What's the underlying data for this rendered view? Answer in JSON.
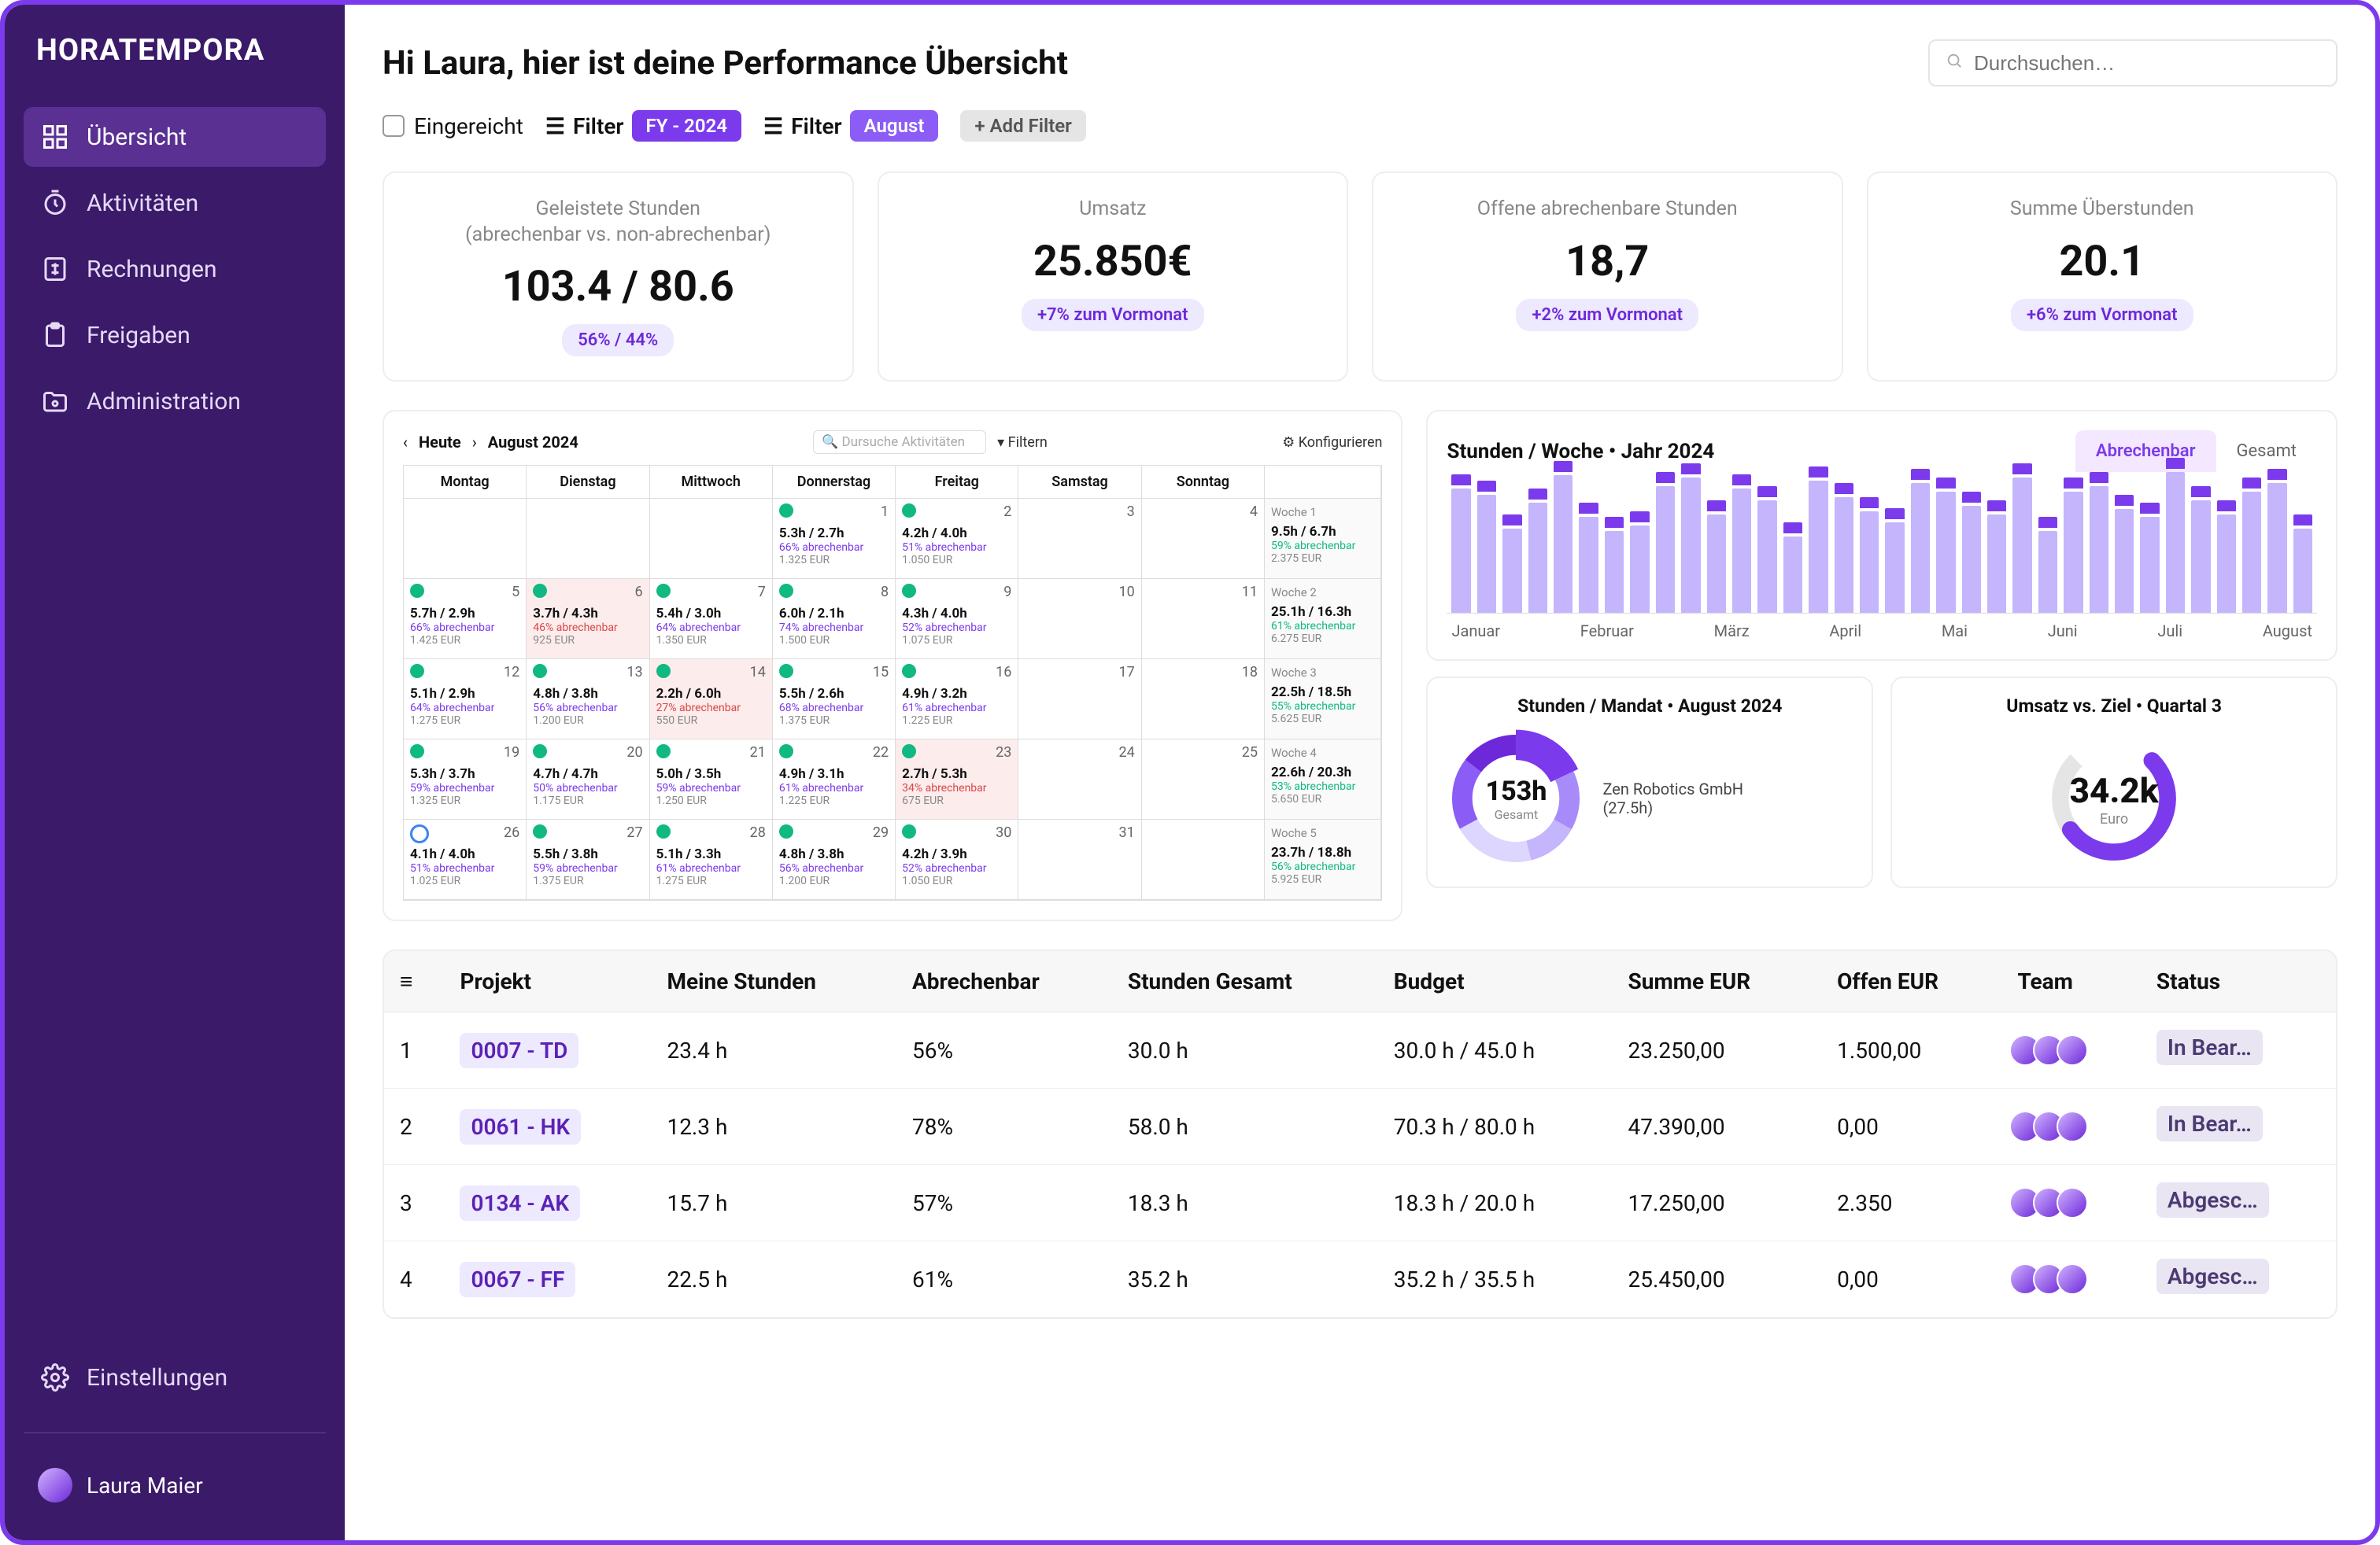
{
  "brand": "HORATEMPORA",
  "sidebar": {
    "items": [
      {
        "label": "Übersicht",
        "icon": "grid-icon",
        "active": true
      },
      {
        "label": "Aktivitäten",
        "icon": "stopwatch-icon"
      },
      {
        "label": "Rechnungen",
        "icon": "invoice-icon"
      },
      {
        "label": "Freigaben",
        "icon": "clipboard-icon"
      },
      {
        "label": "Administration",
        "icon": "folder-gear-icon"
      }
    ],
    "settings_label": "Einstellungen",
    "user_name": "Laura Maier"
  },
  "header": {
    "greeting": "Hi Laura, hier ist deine Performance Übersicht",
    "search_placeholder": "Durchsuchen…"
  },
  "filters": {
    "submitted_label": "Eingereicht",
    "filter_label": "Filter",
    "fy_chip": "FY - 2024",
    "month_chip": "August",
    "add_filter": "+ Add Filter"
  },
  "kpis": [
    {
      "title": "Geleistete Stunden",
      "subtitle": "(abrechenbar vs. non-abrechenbar)",
      "value": "103.4 / 80.6",
      "badge": "56% / 44%"
    },
    {
      "title": "Umsatz",
      "subtitle": "",
      "value": "25.850€",
      "badge": "+7% zum Vormonat"
    },
    {
      "title": "Offene abrechenbare Stunden",
      "subtitle": "",
      "value": "18,7",
      "badge": "+2% zum Vormonat"
    },
    {
      "title": "Summe Überstunden",
      "subtitle": "",
      "value": "20.1",
      "badge": "+6% zum Vormonat"
    }
  ],
  "calendar": {
    "today_label": "Heute",
    "month_label": "August 2024",
    "search_placeholder": "Dursuche Aktivitäten",
    "filter_label": "Filtern",
    "config_label": "Konfigurieren",
    "days": [
      "Montag",
      "Dienstag",
      "Mittwoch",
      "Donnerstag",
      "Freitag",
      "Samstag",
      "Sonntag"
    ],
    "weeks": [
      {
        "label": "Woche 1",
        "hours": "9.5h / 6.7h",
        "pct": "59% abrechenbar",
        "eur": "2.375 EUR"
      },
      {
        "label": "Woche 2",
        "hours": "25.1h / 16.3h",
        "pct": "61% abrechenbar",
        "eur": "6.275 EUR"
      },
      {
        "label": "Woche 3",
        "hours": "22.5h / 18.5h",
        "pct": "55% abrechenbar",
        "eur": "5.625 EUR"
      },
      {
        "label": "Woche 4",
        "hours": "22.6h / 20.3h",
        "pct": "53% abrechenbar",
        "eur": "5.650 EUR"
      },
      {
        "label": "Woche 5",
        "hours": "23.7h / 18.8h",
        "pct": "56% abrechenbar",
        "eur": "5.925 EUR"
      }
    ],
    "cells": [
      [
        null,
        null,
        null,
        {
          "d": 1,
          "m": "green",
          "h": "5.3h / 2.7h",
          "p": "66% abrechenbar",
          "e": "1.325 EUR"
        },
        {
          "d": 2,
          "m": "green",
          "h": "4.2h / 4.0h",
          "p": "51% abrechenbar",
          "e": "1.050 EUR"
        },
        {
          "d": 3
        },
        {
          "d": 4
        }
      ],
      [
        {
          "d": 5,
          "m": "green",
          "h": "5.7h / 2.9h",
          "p": "66% abrechenbar",
          "e": "1.425 EUR"
        },
        {
          "d": 6,
          "m": "green",
          "warn": true,
          "h": "3.7h / 4.3h",
          "p": "46% abrechenbar",
          "e": "925 EUR"
        },
        {
          "d": 7,
          "m": "green",
          "h": "5.4h / 3.0h",
          "p": "64% abrechenbar",
          "e": "1.350 EUR"
        },
        {
          "d": 8,
          "m": "green",
          "h": "6.0h / 2.1h",
          "p": "74% abrechenbar",
          "e": "1.500 EUR"
        },
        {
          "d": 9,
          "m": "green",
          "h": "4.3h / 4.0h",
          "p": "52% abrechenbar",
          "e": "1.075 EUR"
        },
        {
          "d": 10
        },
        {
          "d": 11
        }
      ],
      [
        {
          "d": 12,
          "m": "green",
          "h": "5.1h / 2.9h",
          "p": "64% abrechenbar",
          "e": "1.275 EUR"
        },
        {
          "d": 13,
          "m": "green",
          "h": "4.8h / 3.8h",
          "p": "56% abrechenbar",
          "e": "1.200 EUR"
        },
        {
          "d": 14,
          "m": "green",
          "warn": true,
          "h": "2.2h / 6.0h",
          "p": "27% abrechenbar",
          "e": "550 EUR"
        },
        {
          "d": 15,
          "m": "green",
          "h": "5.5h / 2.6h",
          "p": "68% abrechenbar",
          "e": "1.375 EUR"
        },
        {
          "d": 16,
          "m": "green",
          "h": "4.9h / 3.2h",
          "p": "61% abrechenbar",
          "e": "1.225 EUR"
        },
        {
          "d": 17
        },
        {
          "d": 18
        }
      ],
      [
        {
          "d": 19,
          "m": "green",
          "h": "5.3h / 3.7h",
          "p": "59% abrechenbar",
          "e": "1.325 EUR"
        },
        {
          "d": 20,
          "m": "green",
          "h": "4.7h / 4.7h",
          "p": "50% abrechenbar",
          "e": "1.175 EUR"
        },
        {
          "d": 21,
          "m": "green",
          "h": "5.0h / 3.5h",
          "p": "59% abrechenbar",
          "e": "1.250 EUR"
        },
        {
          "d": 22,
          "m": "green",
          "h": "4.9h / 3.1h",
          "p": "61% abrechenbar",
          "e": "1.225 EUR"
        },
        {
          "d": 23,
          "m": "green",
          "warn": true,
          "h": "2.7h / 5.3h",
          "p": "34% abrechenbar",
          "e": "675 EUR"
        },
        {
          "d": 24
        },
        {
          "d": 25
        }
      ],
      [
        {
          "d": 26,
          "m": "blue",
          "h": "4.1h / 4.0h",
          "p": "51% abrechenbar",
          "e": "1.025 EUR"
        },
        {
          "d": 27,
          "m": "green",
          "h": "5.5h / 3.8h",
          "p": "59% abrechenbar",
          "e": "1.375 EUR"
        },
        {
          "d": 28,
          "m": "green",
          "h": "5.1h / 3.3h",
          "p": "61% abrechenbar",
          "e": "1.275 EUR"
        },
        {
          "d": 29,
          "m": "green",
          "h": "4.8h / 3.8h",
          "p": "56% abrechenbar",
          "e": "1.200 EUR"
        },
        {
          "d": 30,
          "m": "green",
          "h": "4.2h / 3.9h",
          "p": "52% abrechenbar",
          "e": "1.050 EUR"
        },
        {
          "d": 31
        },
        null
      ]
    ]
  },
  "chart_data": {
    "type": "bar",
    "title": "Stunden / Woche  •  Jahr 2024",
    "tabs": [
      "Abrechenbar",
      "Gesamt"
    ],
    "active_tab": "Abrechenbar",
    "month_labels": [
      "Januar",
      "Februar",
      "März",
      "April",
      "Mai",
      "Juni",
      "Juli",
      "August"
    ],
    "values": [
      88,
      84,
      60,
      78,
      98,
      68,
      58,
      62,
      90,
      96,
      70,
      88,
      80,
      54,
      94,
      82,
      72,
      64,
      92,
      86,
      76,
      70,
      96,
      58,
      86,
      90,
      74,
      68,
      100,
      80,
      70,
      86,
      92,
      60
    ],
    "ylim": [
      0,
      100
    ]
  },
  "donut": {
    "title": "Stunden / Mandat  •  August 2024",
    "total_value": "153h",
    "total_label": "Gesamt",
    "highlight_label": "Zen Robotics GmbH",
    "highlight_value": "(27.5h)",
    "segments": [
      {
        "value": 27.5,
        "color": "#7c3aed"
      },
      {
        "value": 23,
        "color": "#a78bfa"
      },
      {
        "value": 20,
        "color": "#c4b5fd"
      },
      {
        "value": 32,
        "color": "#ddd6fe"
      },
      {
        "value": 28,
        "color": "#8b5cf6"
      },
      {
        "value": 22.5,
        "color": "#6d28d9"
      }
    ]
  },
  "gauge": {
    "title": "Umsatz vs. Ziel  •  Quartal 3",
    "value": "34.2k",
    "unit": "Euro",
    "percent": 70
  },
  "table": {
    "columns": [
      "≡",
      "Projekt",
      "Meine Stunden",
      "Abrechenbar",
      "Stunden Gesamt",
      "Budget",
      "Summe EUR",
      "Offen EUR",
      "Team",
      "Status"
    ],
    "rows": [
      {
        "n": "1",
        "proj": "0007 - TD",
        "mine": "23.4 h",
        "bill": "56%",
        "total": "30.0 h",
        "budget": "30.0 h / 45.0 h",
        "sum": "23.250,00",
        "open": "1.500,00",
        "status": "In Bear…"
      },
      {
        "n": "2",
        "proj": "0061 - HK",
        "mine": "12.3 h",
        "bill": "78%",
        "total": "58.0 h",
        "budget": "70.3 h / 80.0 h",
        "sum": "47.390,00",
        "open": "0,00",
        "status": "In Bear…"
      },
      {
        "n": "3",
        "proj": "0134 - AK",
        "mine": "15.7 h",
        "bill": "57%",
        "total": "18.3 h",
        "budget": "18.3 h / 20.0 h",
        "sum": "17.250,00",
        "open": "2.350",
        "status": "Abgesc…"
      },
      {
        "n": "4",
        "proj": "0067 - FF",
        "mine": "22.5 h",
        "bill": "61%",
        "total": "35.2 h",
        "budget": "35.2 h / 35.5 h",
        "sum": "25.450,00",
        "open": "0,00",
        "status": "Abgesc…"
      }
    ]
  }
}
